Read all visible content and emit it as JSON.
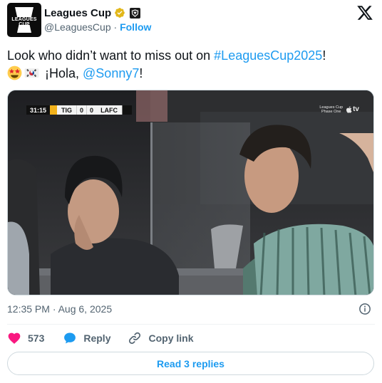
{
  "account": {
    "display_name": "Leagues Cup",
    "handle": "@LeaguesCup",
    "separator": "·",
    "follow_label": "Follow",
    "avatar_text": "LEAGUES CUP"
  },
  "tweet": {
    "text_prefix": "Look who didn’t want to miss out on ",
    "hashtag": "#LeaguesCup2025",
    "text_suffix": "!",
    "line2_text": "¡Hola, ",
    "mention": "@Sonny7",
    "line2_suffix": "!",
    "emojis": [
      "star-struck-emoji",
      "south-korea-flag-emoji"
    ]
  },
  "media": {
    "scorebug": {
      "time": "31:15",
      "home_team": "TIG",
      "home_score": "0",
      "away_score": "0",
      "away_team": "LAFC"
    },
    "broadcast_tag_line1": "Leagues Cup",
    "broadcast_tag_line2": "Phase One",
    "broadcast_tv": "tv"
  },
  "meta": {
    "timestamp": "12:35 PM · Aug 6, 2025"
  },
  "actions": {
    "like_count": "573",
    "reply_label": "Reply",
    "copy_link_label": "Copy link"
  },
  "footer": {
    "read_replies_label": "Read 3 replies"
  },
  "colors": {
    "link_blue": "#1d9bf0",
    "like_red": "#f91880",
    "secondary_text": "#536471",
    "verified_gold": "#e2b719"
  }
}
